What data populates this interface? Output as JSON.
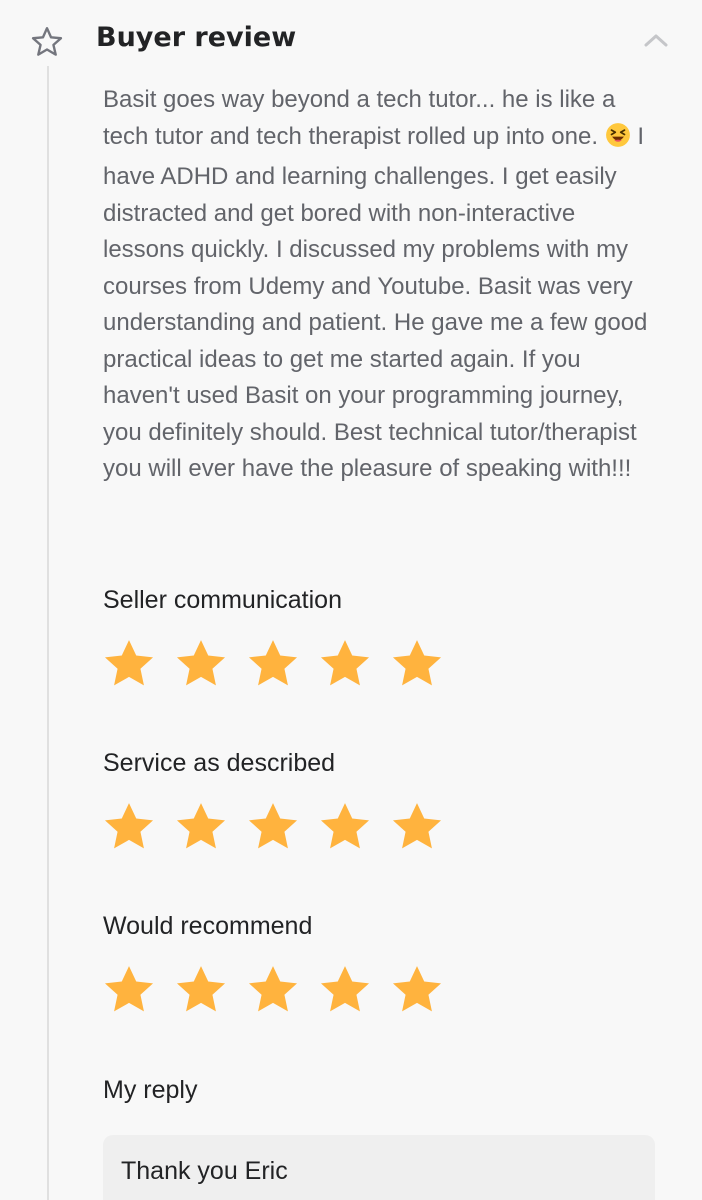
{
  "header": {
    "title": "Buyer review",
    "icon": "star-outline-icon",
    "toggle_icon": "chevron-up-icon"
  },
  "review": {
    "text_before_emoji": "Basit goes way beyond a tech tutor... he is like a tech tutor and tech therapist rolled up into one. ",
    "emoji": "laughing-face-emoji",
    "text_after_emoji": " I have ADHD and learning challenges. I get easily distracted and get bored with non-interactive lessons quickly. I discussed my problems with my courses from Udemy and Youtube. Basit was very understanding and patient. He gave me a few good practical ideas to get me started again. If you haven't used Basit on your programming journey, you definitely should. Best technical tutor/therapist you will ever have the pleasure of speaking with!!!"
  },
  "ratings": [
    {
      "label": "Seller communication",
      "stars": 5,
      "max": 5
    },
    {
      "label": "Service as described",
      "stars": 5,
      "max": 5
    },
    {
      "label": "Would recommend",
      "stars": 5,
      "max": 5
    }
  ],
  "reply": {
    "label": "My reply",
    "text": "Thank you Eric"
  },
  "colors": {
    "star_fill": "#ffb33e",
    "icon_gray": "#74767e",
    "heading": "#222325",
    "body_text": "#62646a",
    "background": "#f8f8f8",
    "reply_bg": "#efefef"
  }
}
